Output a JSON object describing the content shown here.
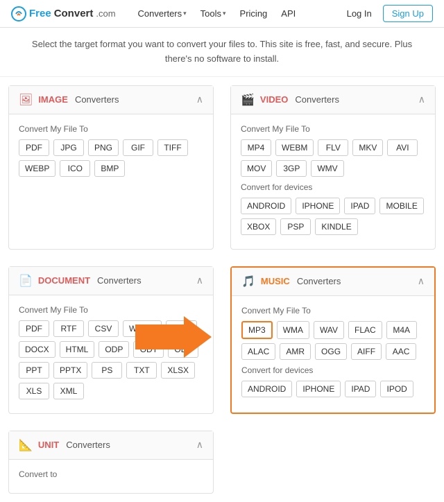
{
  "nav": {
    "logo": {
      "free": "Free",
      "convert": "Convert",
      "com": ".com"
    },
    "links": [
      {
        "id": "converters",
        "label": "Converters",
        "hasDropdown": true
      },
      {
        "id": "tools",
        "label": "Tools",
        "hasDropdown": true
      },
      {
        "id": "pricing",
        "label": "Pricing",
        "hasDropdown": false
      },
      {
        "id": "api",
        "label": "API",
        "hasDropdown": false
      }
    ],
    "login_label": "Log In",
    "signup_label": "Sign Up"
  },
  "subtitle": {
    "line1": "Select the target format you want to convert your files to. This site is free, fast, and secure. Plus",
    "line2": "there's no software to install."
  },
  "cards": {
    "image": {
      "title_word": "IMAGE",
      "title_rest": "Converters",
      "section_label": "Convert My File To",
      "formats": [
        "PDF",
        "JPG",
        "PNG",
        "GIF",
        "TIFF",
        "WEBP",
        "ICO",
        "BMP"
      ]
    },
    "video": {
      "title_word": "VIDEO",
      "title_rest": "Converters",
      "section_label": "Convert My File To",
      "formats": [
        "MP4",
        "WEBM",
        "FLV",
        "MKV",
        "AVI",
        "MOV",
        "3GP",
        "WMV"
      ],
      "devices_label": "Convert for devices",
      "devices": [
        "ANDROID",
        "IPHONE",
        "IPAD",
        "MOBILE",
        "XBOX",
        "PSP",
        "KINDLE"
      ]
    },
    "document": {
      "title_word": "DOCUMENT",
      "title_rest": "Converters",
      "section_label": "Convert My File To",
      "formats": [
        "PDF",
        "RTF",
        "CSV",
        "WORD",
        "DOC",
        "DOCX",
        "HTML",
        "ODP",
        "ODT",
        "ODS",
        "PPT",
        "PPTX",
        "PS",
        "TXT",
        "XLSX",
        "XLS",
        "XML"
      ]
    },
    "music": {
      "title_word": "MUSIC",
      "title_rest": "Converters",
      "section_label": "Convert My File To",
      "formats": [
        "MP3",
        "WMA",
        "WAV",
        "FLAC",
        "M4A",
        "ALAC",
        "AMR",
        "OGG",
        "AIFF",
        "AAC"
      ],
      "devices_label": "Convert for devices",
      "devices": [
        "ANDROID",
        "IPHONE",
        "IPAD",
        "IPOD"
      ],
      "highlighted_format": "MP3"
    },
    "unit": {
      "title_word": "UNIT",
      "title_rest": "Converters",
      "section_label": "Convert to"
    }
  }
}
